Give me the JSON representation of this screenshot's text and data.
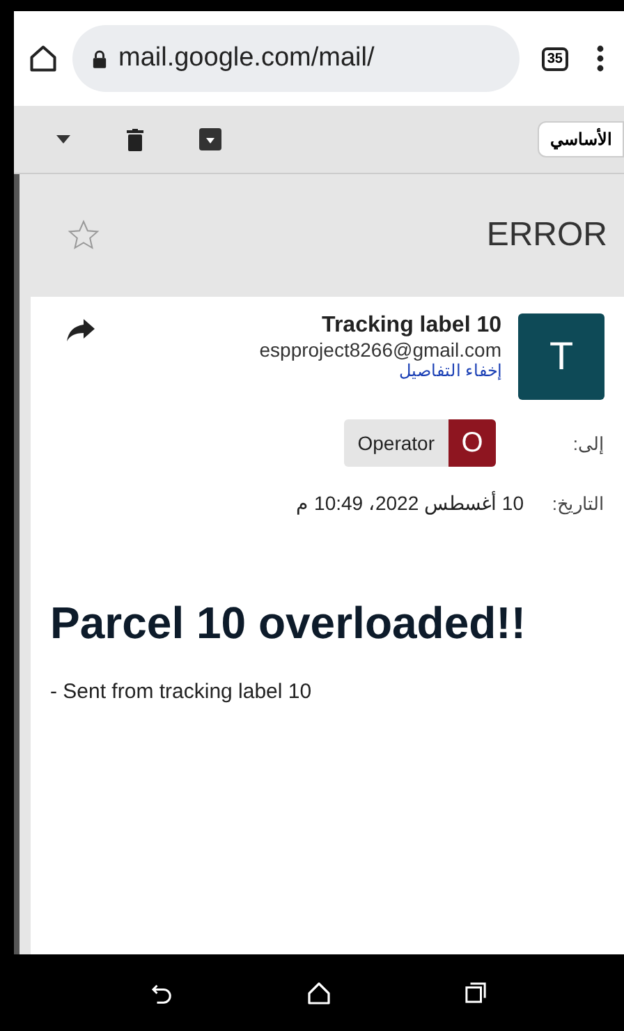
{
  "browser": {
    "url": "mail.google.com/mail/",
    "tab_count": "35"
  },
  "toolbar": {
    "category": "الأساسي"
  },
  "message": {
    "subject": "ERROR",
    "starred": false
  },
  "sender": {
    "initial": "T",
    "name": "Tracking label 10",
    "email": "espproject8266@gmail.com",
    "hide_details": "إخفاء التفاصيل"
  },
  "recipient": {
    "label": "إلى:",
    "name": "Operator",
    "initial": "O"
  },
  "date": {
    "label": "التاريخ:",
    "value": "10 أغسطس 2022، 10:49 م"
  },
  "body": {
    "heading": "Parcel 10 overloaded!!",
    "text": "- Sent from tracking label 10"
  }
}
